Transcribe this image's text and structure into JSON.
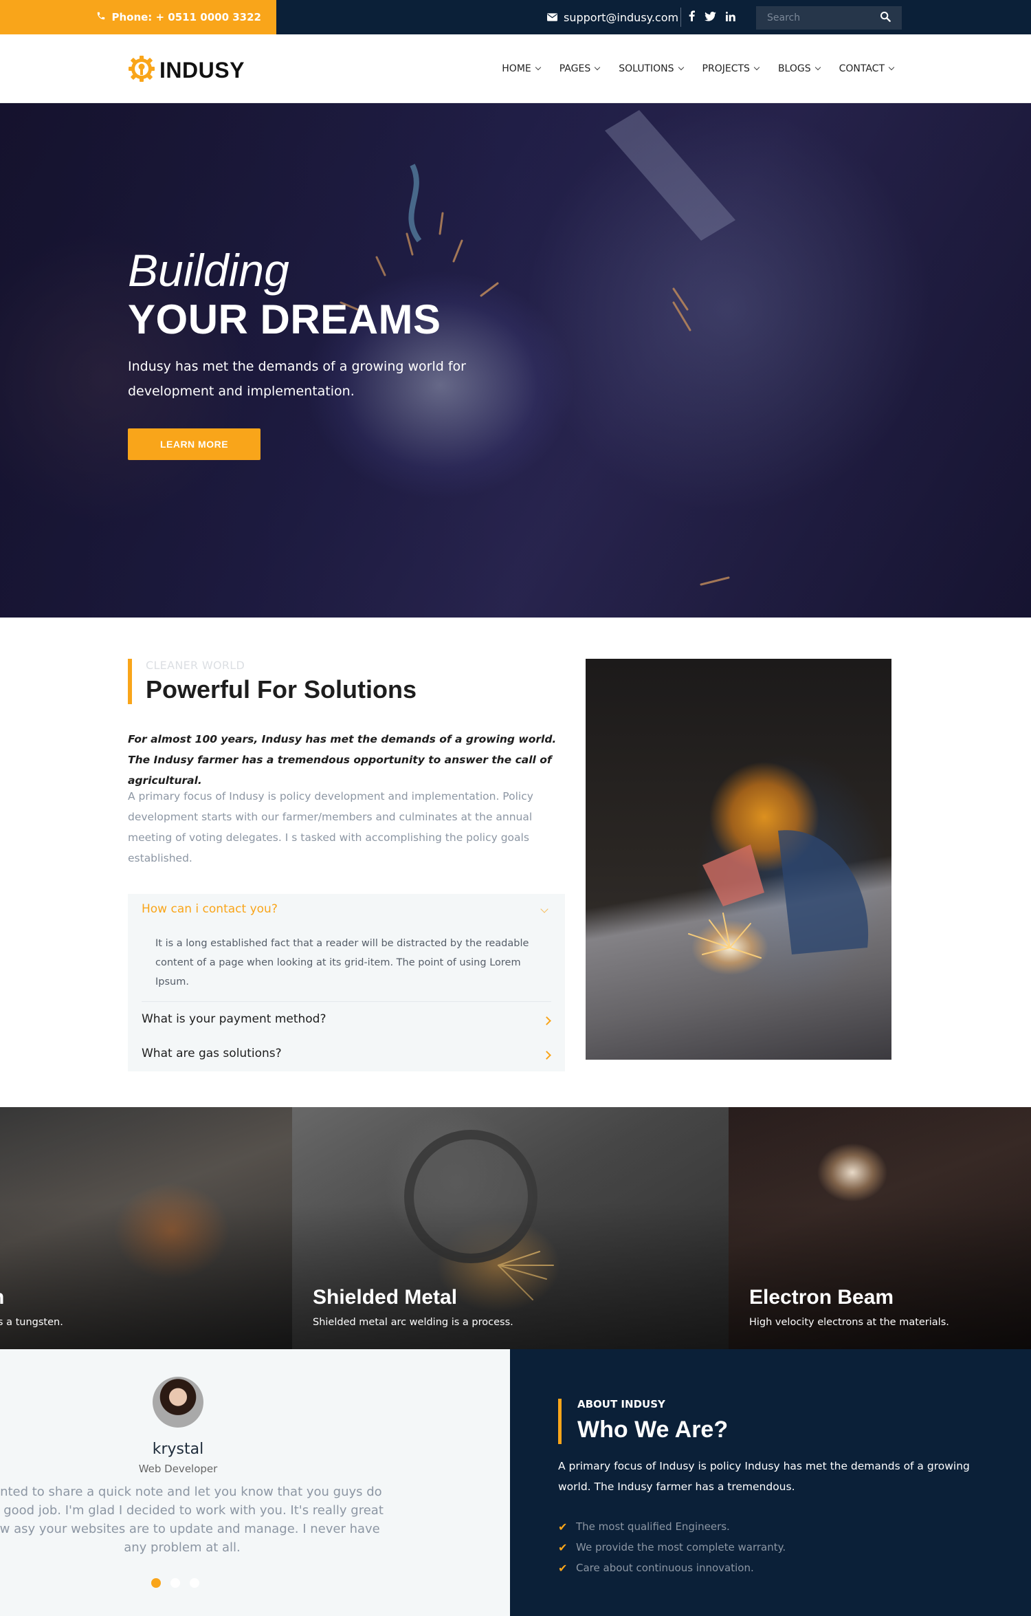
{
  "topbar": {
    "phone": "Phone: + 0511 0000 3322",
    "email": "support@indusy.com",
    "socials": [
      "f",
      "t",
      "in"
    ],
    "search_placeholder": "Search"
  },
  "brand": {
    "name": "INDUSY"
  },
  "nav": {
    "items": [
      {
        "label": "HOME"
      },
      {
        "label": "PAGES"
      },
      {
        "label": "SOLUTIONS"
      },
      {
        "label": "PROJECTS"
      },
      {
        "label": "BLOGS"
      },
      {
        "label": "CONTACT"
      }
    ]
  },
  "hero": {
    "title_line1": "Building",
    "title_line2": "YOUR DREAMS",
    "text": "Indusy has met the demands of a growing world for development and implementation.",
    "button": "LEARN MORE"
  },
  "solutions": {
    "eyebrow": "CLEANER WORLD",
    "title": "Powerful For Solutions",
    "lead": "For almost 100 years, Indusy has met the demands of a growing world. The Indusy farmer has a tremendous opportunity to answer the call of agricultural.",
    "body": "A primary focus of Indusy is policy development and implementation. Policy development starts with our farmer/members and culminates at the annual meeting of voting delegates. I s tasked with accomplishing the policy goals established."
  },
  "faq": {
    "items": [
      {
        "question": "How can i contact you?",
        "answer": "It is a long established fact that a reader will be distracted by the readable content of a page when looking at its grid-item. The point of using Lorem Ipsum."
      },
      {
        "question": "What is your payment method?"
      },
      {
        "question": "What are gas solutions?"
      }
    ]
  },
  "gallery": {
    "tiles": [
      {
        "title": "n",
        "subtitle": "es a tungsten."
      },
      {
        "title": "Shielded Metal",
        "subtitle": "Shielded metal arc welding is a process."
      },
      {
        "title": "Electron Beam",
        "subtitle": "High velocity electrons at the materials."
      }
    ]
  },
  "testimonial": {
    "name": "krystal",
    "role": "Web Developer",
    "quote": "wanted to share a quick note and let you know that you guys do a y good job. I'm glad I decided to work with you. It's really great how asy your websites are to update and manage. I never have any problem at all.",
    "active_dot": 0,
    "dot_count": 3
  },
  "about": {
    "eyebrow": "ABOUT INDUSY",
    "title": "Who We Are?",
    "text": "A primary focus of Indusy is policy Indusy has met the demands of a growing world. The Indusy farmer has a tremendous.",
    "list": [
      "The most qualified Engineers.",
      "We provide the most complete warranty.",
      "Care about continuous innovation."
    ]
  },
  "colors": {
    "accent": "#f9a51a",
    "navy": "#0b2038",
    "light_bg": "#f4f7f8",
    "muted_text": "#8c96a3"
  },
  "icons": [
    "phone-icon",
    "envelope-icon",
    "facebook-icon",
    "twitter-icon",
    "linkedin-icon",
    "search-icon",
    "gear-logo-icon",
    "check-icon",
    "chevron-right-icon",
    "chevron-down-icon"
  ]
}
